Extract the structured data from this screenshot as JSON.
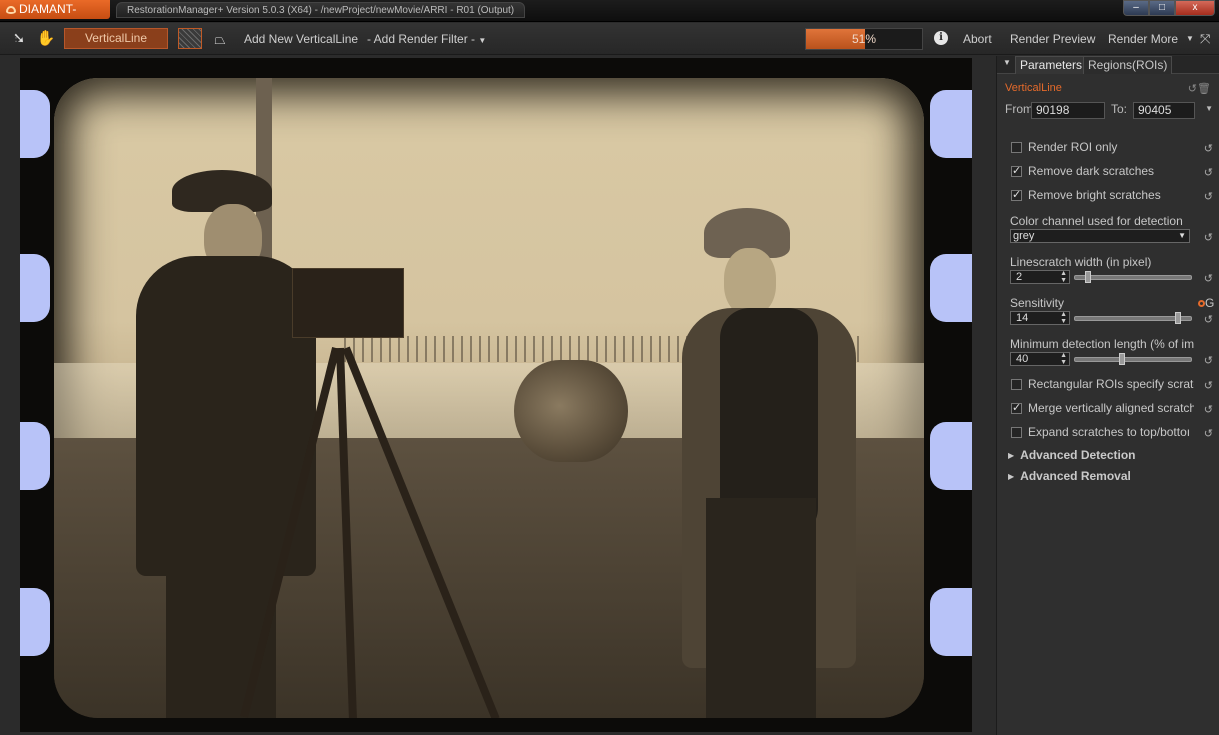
{
  "titlebar": {
    "app_name": "DIAMANT-Film",
    "window_title": "RestorationManager+ Version 5.0.3 (X64) - /newProject/newMovie/ARRI - R01 (Output)",
    "minimize": "–",
    "maximize": "□",
    "close": "x"
  },
  "toolbar": {
    "filter_name": "VerticalLine",
    "add_new": "Add New VerticalLine",
    "add_render_filter": "- Add Render Filter -",
    "progress_label": "51%",
    "progress_value": 0.51,
    "info": "i",
    "abort": "Abort",
    "render_preview": "Render Preview",
    "render_more": "Render More",
    "accent_color": "#d0642a"
  },
  "panel": {
    "tabs": [
      "Parameters",
      "Regions(ROIs)"
    ],
    "filter_title": "VerticalLine",
    "from_label": "From:",
    "from_value": "90198",
    "to_label": "To:",
    "to_value": "90405",
    "checks": [
      {
        "label": "Render ROI only",
        "checked": false
      },
      {
        "label": "Remove dark scratches",
        "checked": true
      },
      {
        "label": "Remove bright scratches",
        "checked": true
      }
    ],
    "color_channel_label": "Color channel used for detection",
    "color_channel_value": "grey",
    "linescratch_label": "Linescratch width (in pixel)",
    "linescratch_value": "2",
    "sensitivity_label": "Sensitivity",
    "sensitivity_value": "14",
    "sensitivity_extra": "G",
    "min_length_label": "Minimum detection length (% of im",
    "min_length_value": "40",
    "checks2": [
      {
        "label": "Rectangular ROIs specify scratc",
        "checked": false
      },
      {
        "label": "Merge vertically aligned scratche",
        "checked": true
      },
      {
        "label": "Expand scratches to top/bottoı",
        "checked": false
      }
    ],
    "advanced_detection": "Advanced Detection",
    "advanced_removal": "Advanced Removal"
  }
}
